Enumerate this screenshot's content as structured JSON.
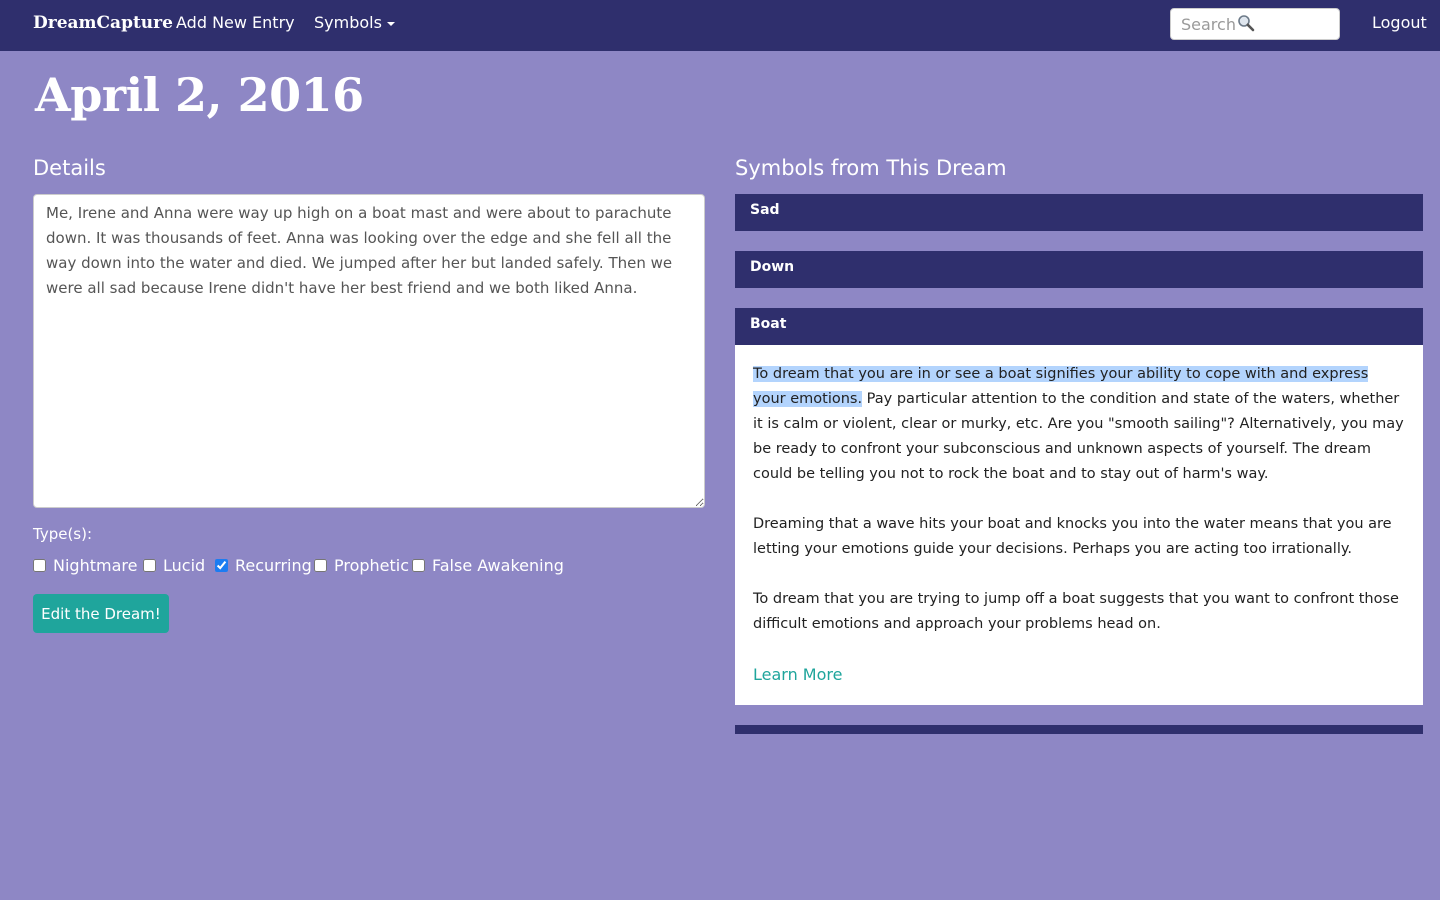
{
  "nav": {
    "brand": "DreamCapture",
    "add_entry": "Add New Entry",
    "symbols": "Symbols",
    "search_placeholder": "Search",
    "logout": "Logout"
  },
  "page": {
    "date_title": "April 2, 2016"
  },
  "details": {
    "heading": "Details",
    "text": "Me, Irene and Anna were way up high on a boat mast and were about to parachute down. It was thousands of feet. Anna was looking over the edge and she fell all the way down into the water and died. We jumped after her but landed safely. Then we were all sad because Irene didn't have her best friend and we both liked Anna.",
    "types_label": "Type(s):",
    "types": [
      {
        "label": "Nightmare",
        "checked": false
      },
      {
        "label": "Lucid",
        "checked": false
      },
      {
        "label": "Recurring",
        "checked": true
      },
      {
        "label": "Prophetic",
        "checked": false
      },
      {
        "label": "False Awakening",
        "checked": false
      }
    ],
    "edit_button": "Edit the Dream!"
  },
  "symbols": {
    "heading": "Symbols from This Dream",
    "panels": [
      {
        "title": "Sad"
      },
      {
        "title": "Down"
      },
      {
        "title": "Boat"
      }
    ],
    "boat_body": {
      "p1_highlight": "To dream that you are in or see a boat signifies your ability to cope with and express your emotions.",
      "p1_rest": " Pay particular attention to the condition and state of the waters, whether it is calm or violent, clear or murky, etc. Are you \"smooth sailing\"? Alternatively, you may be ready to confront your subconscious and unknown aspects of yourself. The dream could be telling you not to rock the boat and to stay out of harm's way.",
      "p2": "Dreaming that a wave hits your boat and knocks you into the water means that you are letting your emotions guide your decisions. Perhaps you are acting too irrationally.",
      "p3": "To dream that you are trying to jump off a boat suggests that  you want to confront those difficult emotions and approach your  problems head on.",
      "learn_more": "Learn More"
    }
  },
  "colors": {
    "background": "#8e87c5",
    "navbar": "#2f2f6d",
    "accent": "#1fa59c",
    "selection": "#b3d4fd"
  }
}
